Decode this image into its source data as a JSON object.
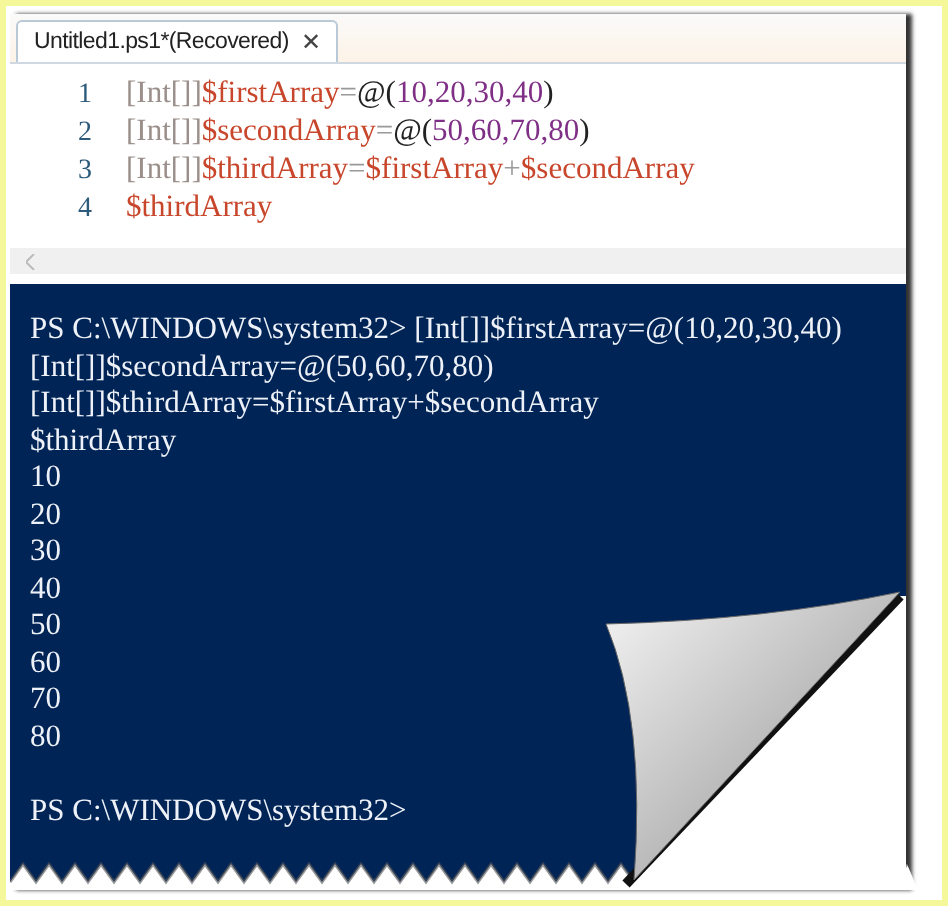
{
  "tab": {
    "title": "Untitled1.ps1*(Recovered)",
    "close": "✕",
    "selected": true
  },
  "editor": {
    "lines": [
      {
        "number": "1",
        "tokens": [
          {
            "kind": "type",
            "text": "[Int[]]"
          },
          {
            "kind": "variable",
            "text": "$firstArray"
          },
          {
            "kind": "operator",
            "text": "="
          },
          {
            "kind": "plain",
            "text": "@("
          },
          {
            "kind": "number",
            "text": "10,20,30,40"
          },
          {
            "kind": "plain",
            "text": ")"
          }
        ]
      },
      {
        "number": "2",
        "tokens": [
          {
            "kind": "type",
            "text": "[Int[]]"
          },
          {
            "kind": "variable",
            "text": "$secondArray"
          },
          {
            "kind": "operator",
            "text": "="
          },
          {
            "kind": "plain",
            "text": "@("
          },
          {
            "kind": "number",
            "text": "50,60,70,80"
          },
          {
            "kind": "plain",
            "text": ")"
          }
        ]
      },
      {
        "number": "3",
        "tokens": [
          {
            "kind": "type",
            "text": "[Int[]]"
          },
          {
            "kind": "variable",
            "text": "$thirdArray"
          },
          {
            "kind": "operator",
            "text": "="
          },
          {
            "kind": "variable",
            "text": "$firstArray"
          },
          {
            "kind": "operator",
            "text": "+"
          },
          {
            "kind": "variable",
            "text": "$secondArray"
          }
        ]
      },
      {
        "number": "4",
        "tokens": [
          {
            "kind": "variable",
            "text": "$thirdArray"
          }
        ]
      }
    ]
  },
  "console": {
    "lines": [
      "PS C:\\WINDOWS\\system32> [Int[]]$firstArray=@(10,20,30,40)",
      "[Int[]]$secondArray=@(50,60,70,80)",
      "[Int[]]$thirdArray=$firstArray+$secondArray",
      "$thirdArray",
      "10",
      "20",
      "30",
      "40",
      "50",
      "60",
      "70",
      "80"
    ],
    "prompt": "PS C:\\WINDOWS\\system32>"
  }
}
